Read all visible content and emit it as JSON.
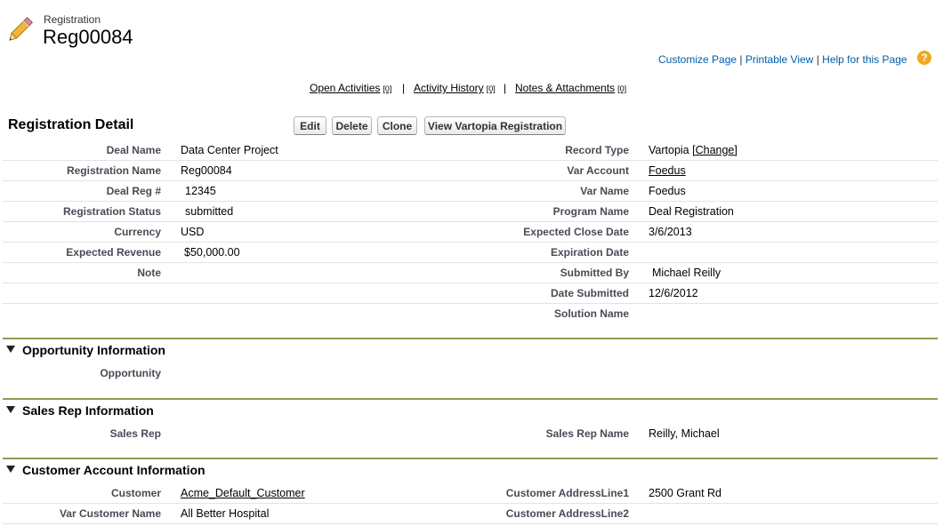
{
  "header": {
    "object_label": "Registration",
    "record_name": "Reg00084",
    "icon": "pencil-icon"
  },
  "top_links": {
    "customize": "Customize Page",
    "sep1": "|",
    "printable": "Printable View",
    "sep2": "|",
    "help": "Help for this Page",
    "help_icon": "help-icon"
  },
  "related_links": {
    "open_activities": {
      "label": "Open Activities",
      "count": "[0]"
    },
    "activity_history": {
      "label": "Activity History",
      "count": "[0]"
    },
    "notes_attachments": {
      "label": "Notes & Attachments",
      "count": "[0]"
    },
    "sep": "|"
  },
  "detail": {
    "title": "Registration Detail",
    "buttons": {
      "edit": "Edit",
      "delete": "Delete",
      "clone": "Clone",
      "view_vartopia": "View Vartopia Registration"
    },
    "left": [
      {
        "label": "Deal Name",
        "value": "Data Center Project"
      },
      {
        "label": "Registration Name",
        "value": "Reg00084"
      },
      {
        "label": "Deal Reg #",
        "value": "12345"
      },
      {
        "label": "Registration Status",
        "value": "submitted"
      },
      {
        "label": "Currency",
        "value": "USD"
      },
      {
        "label": "Expected Revenue",
        "value": "$50,000.00"
      },
      {
        "label": "Note",
        "value": ""
      }
    ],
    "right": [
      {
        "label": "Record Type",
        "value": "Vartopia",
        "link": "[Change]"
      },
      {
        "label": "Var Account",
        "value": "Foedus"
      },
      {
        "label": "Var Name",
        "value": "Foedus"
      },
      {
        "label": "Program Name",
        "value": "Deal Registration"
      },
      {
        "label": "Expected Close Date",
        "value": "3/6/2013"
      },
      {
        "label": "Expiration Date",
        "value": ""
      },
      {
        "label": "Submitted By",
        "value": "Michael Reilly"
      },
      {
        "label": "Date Submitted",
        "value": "12/6/2012"
      },
      {
        "label": "Solution Name",
        "value": ""
      }
    ]
  },
  "sections": {
    "opportunity": {
      "title": "Opportunity Information",
      "left_label": "Opportunity",
      "left_value": ""
    },
    "sales_rep": {
      "title": "Sales Rep Information",
      "left_label": "Sales Rep",
      "left_value": "",
      "right_label": "Sales Rep Name",
      "right_value": "Reilly, Michael"
    },
    "customer": {
      "title": "Customer Account Information",
      "rows": [
        {
          "left_label": "Customer",
          "left_value": "Acme_Default_Customer",
          "right_label": "Customer AddressLine1",
          "right_value": "2500 Grant Rd"
        },
        {
          "left_label": "Var Customer Name",
          "left_value": "All Better Hospital",
          "right_label": "Customer AddressLine2",
          "right_value": ""
        }
      ]
    }
  },
  "colors": {
    "link": "#015ba7",
    "section_line": "#8e9a53",
    "label": "#4a4a56"
  }
}
